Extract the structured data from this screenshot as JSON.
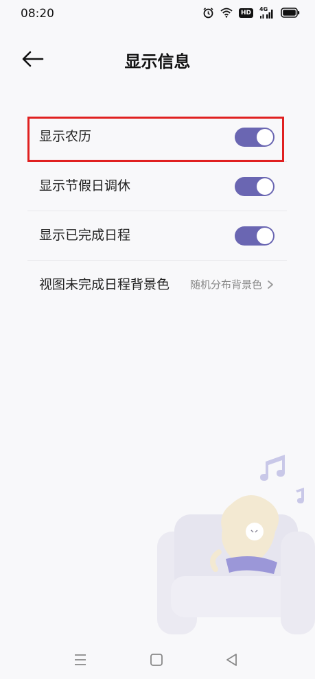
{
  "status_bar": {
    "time": "08:20",
    "icons": [
      "alarm-icon",
      "wifi-icon",
      "hd-icon",
      "signal-icon",
      "battery-icon"
    ],
    "hd_label": "HD",
    "network_label": "4G"
  },
  "header": {
    "title": "显示信息",
    "back_icon": "back-arrow-icon"
  },
  "settings": {
    "items": [
      {
        "label": "显示农历",
        "type": "toggle",
        "on": true
      },
      {
        "label": "显示节假日调休",
        "type": "toggle",
        "on": true
      },
      {
        "label": "显示已完成日程",
        "type": "toggle",
        "on": true
      },
      {
        "label": "视图未完成日程背景色",
        "type": "select",
        "value": "随机分布背景色"
      }
    ]
  },
  "colors": {
    "accent": "#6a66b2",
    "highlight": "#e02020",
    "background": "#f8f8fa"
  },
  "nav_bar": {
    "icons": [
      "menu-icon",
      "home-icon",
      "back-icon"
    ]
  }
}
